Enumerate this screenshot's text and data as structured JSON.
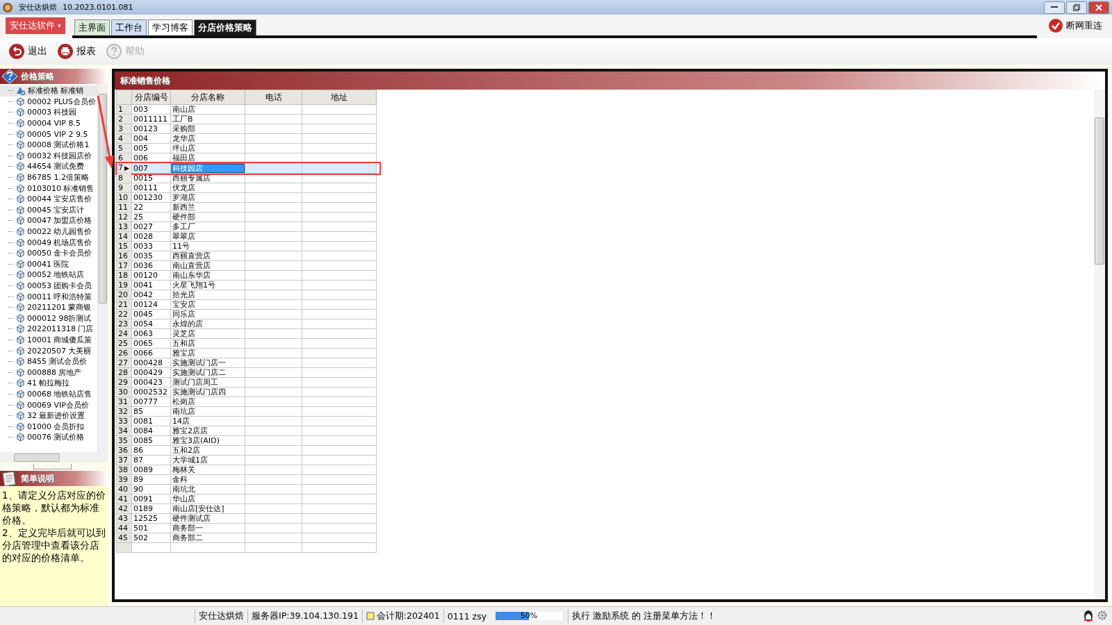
{
  "window": {
    "title": "安仕达烘焙",
    "version": "10.2023.0101.081"
  },
  "menu_button": {
    "label": "安仕达软件",
    "caret": "▾"
  },
  "tabs": [
    {
      "label": "主界面",
      "selected": false,
      "color": "#d8ecd8"
    },
    {
      "label": "工作台",
      "selected": false,
      "color": "#cfe0f5"
    },
    {
      "label": "学习博客",
      "selected": false,
      "color": "#ffffff"
    },
    {
      "label": "分店价格策略",
      "selected": true,
      "color": "#1a1a1a"
    }
  ],
  "reconnect_button": {
    "label": "断网重连"
  },
  "toolbar": [
    {
      "label": "退出",
      "kind": "exit",
      "disabled": false
    },
    {
      "label": "报表",
      "kind": "print",
      "disabled": false
    },
    {
      "label": "帮助",
      "kind": "help",
      "disabled": true
    }
  ],
  "price_tree": {
    "title": "价格策略",
    "items": [
      {
        "label": "标准价格 标准销",
        "kind": "root",
        "selected": true
      },
      {
        "label": "00002 PLUS会员价",
        "kind": "leaf",
        "selected": false
      },
      {
        "label": "00003 科技园",
        "kind": "leaf",
        "selected": false
      },
      {
        "label": "00004 VIP 8.5",
        "kind": "leaf",
        "selected": false
      },
      {
        "label": "00005 VIP 2 9.5",
        "kind": "leaf",
        "selected": false
      },
      {
        "label": "00008 测试价格1",
        "kind": "leaf",
        "selected": false
      },
      {
        "label": "00032 科技园店价",
        "kind": "leaf",
        "selected": false
      },
      {
        "label": "44654 测试免费",
        "kind": "leaf",
        "selected": false
      },
      {
        "label": "86785 1.2倍策略",
        "kind": "leaf",
        "selected": false
      },
      {
        "label": "0103010 标准销售",
        "kind": "leaf",
        "selected": false
      },
      {
        "label": "00044 宝安店售价",
        "kind": "leaf",
        "selected": false
      },
      {
        "label": "00045 宝安店计",
        "kind": "leaf",
        "selected": false
      },
      {
        "label": "00047 加盟店价格",
        "kind": "leaf",
        "selected": false
      },
      {
        "label": "00022 幼儿园售价",
        "kind": "leaf",
        "selected": false
      },
      {
        "label": "00049 机场店售价",
        "kind": "leaf",
        "selected": false
      },
      {
        "label": "00050 金卡会员价",
        "kind": "leaf",
        "selected": false
      },
      {
        "label": "00041 医院",
        "kind": "leaf",
        "selected": false
      },
      {
        "label": "00052 地铁站店",
        "kind": "leaf",
        "selected": false
      },
      {
        "label": "00053 团购卡会员",
        "kind": "leaf",
        "selected": false
      },
      {
        "label": "00011 呼和浩特策",
        "kind": "leaf",
        "selected": false
      },
      {
        "label": "20211201 蒙商银",
        "kind": "leaf",
        "selected": false
      },
      {
        "label": "000012 98折测试",
        "kind": "leaf",
        "selected": false
      },
      {
        "label": "2022011318 门店",
        "kind": "leaf",
        "selected": false
      },
      {
        "label": "10001 商城傻瓜策",
        "kind": "leaf",
        "selected": false
      },
      {
        "label": "20220507 大美丽",
        "kind": "leaf",
        "selected": false
      },
      {
        "label": "8455 测试会员价",
        "kind": "leaf",
        "selected": false
      },
      {
        "label": "000888 房地产",
        "kind": "leaf",
        "selected": false
      },
      {
        "label": "41 帕拉梅拉",
        "kind": "leaf",
        "selected": false
      },
      {
        "label": "00068 地铁站店售",
        "kind": "leaf",
        "selected": false
      },
      {
        "label": "00069 VIP会员价",
        "kind": "leaf",
        "selected": false
      },
      {
        "label": "32 最新进价设置",
        "kind": "leaf",
        "selected": false
      },
      {
        "label": "01000 会员折扣",
        "kind": "leaf",
        "selected": false
      },
      {
        "label": "00076 测试价格",
        "kind": "leaf",
        "selected": false
      }
    ]
  },
  "description": {
    "title": "简单说明",
    "paragraphs": [
      "1、请定义分店对应的价格策略，默认都为标准价格。",
      "2、定义完毕后就可以到分店管理中查看该分店的对应的价格清单。"
    ]
  },
  "table": {
    "title": "标准销售价格",
    "row_pointer": "▶",
    "columns": [
      "分店编号",
      "分店名称",
      "电话",
      "地址"
    ],
    "rows": [
      {
        "n": "1",
        "code": "003",
        "name": "南山店",
        "selected": false
      },
      {
        "n": "2",
        "code": "0011111",
        "name": "工厂B",
        "selected": false
      },
      {
        "n": "3",
        "code": "00123",
        "name": "采购部",
        "selected": false
      },
      {
        "n": "4",
        "code": "004",
        "name": "龙华店",
        "selected": false
      },
      {
        "n": "5",
        "code": "005",
        "name": "坪山店",
        "selected": false
      },
      {
        "n": "6",
        "code": "006",
        "name": "福田店",
        "selected": false
      },
      {
        "n": "7",
        "code": "007",
        "name": "科技园店",
        "selected": true
      },
      {
        "n": "8",
        "code": "0015",
        "name": "西丽专属店",
        "selected": false
      },
      {
        "n": "9",
        "code": "00111",
        "name": "伏龙店",
        "selected": false
      },
      {
        "n": "10",
        "code": "001230",
        "name": "罗湖店",
        "selected": false
      },
      {
        "n": "11",
        "code": "22",
        "name": "新西兰",
        "selected": false
      },
      {
        "n": "12",
        "code": "25",
        "name": "硬件部",
        "selected": false
      },
      {
        "n": "13",
        "code": "0027",
        "name": "多工厂",
        "selected": false
      },
      {
        "n": "14",
        "code": "0028",
        "name": "翠翠店",
        "selected": false
      },
      {
        "n": "15",
        "code": "0033",
        "name": "11号",
        "selected": false
      },
      {
        "n": "16",
        "code": "0035",
        "name": "西丽直营店",
        "selected": false
      },
      {
        "n": "17",
        "code": "0036",
        "name": "南山直营店",
        "selected": false
      },
      {
        "n": "18",
        "code": "00120",
        "name": "南山东华店",
        "selected": false
      },
      {
        "n": "19",
        "code": "0041",
        "name": "火星飞翔1号",
        "selected": false
      },
      {
        "n": "20",
        "code": "0042",
        "name": "拾光店",
        "selected": false
      },
      {
        "n": "21",
        "code": "00124",
        "name": "宝安店",
        "selected": false
      },
      {
        "n": "22",
        "code": "0045",
        "name": "同乐店",
        "selected": false
      },
      {
        "n": "23",
        "code": "0054",
        "name": "永煌的店",
        "selected": false
      },
      {
        "n": "24",
        "code": "0063",
        "name": "灵芝店",
        "selected": false
      },
      {
        "n": "25",
        "code": "0065",
        "name": "五和店",
        "selected": false
      },
      {
        "n": "26",
        "code": "0066",
        "name": "雅宝店",
        "selected": false
      },
      {
        "n": "27",
        "code": "000428",
        "name": "实施测试门店一",
        "selected": false
      },
      {
        "n": "28",
        "code": "000429",
        "name": "实施测试门店二",
        "selected": false
      },
      {
        "n": "29",
        "code": "000423",
        "name": "测试门店周工",
        "selected": false
      },
      {
        "n": "30",
        "code": "0002532",
        "name": "实施测试门店四",
        "selected": false
      },
      {
        "n": "31",
        "code": "00777",
        "name": "松岗店",
        "selected": false
      },
      {
        "n": "32",
        "code": "85",
        "name": "南坑店",
        "selected": false
      },
      {
        "n": "33",
        "code": "0081",
        "name": "14店",
        "selected": false
      },
      {
        "n": "34",
        "code": "0084",
        "name": "雅宝2店店",
        "selected": false
      },
      {
        "n": "35",
        "code": "0085",
        "name": "雅宝3店(AIO)",
        "selected": false
      },
      {
        "n": "36",
        "code": "86",
        "name": "五和2店",
        "selected": false
      },
      {
        "n": "37",
        "code": "87",
        "name": "大学城1店",
        "selected": false
      },
      {
        "n": "38",
        "code": "0089",
        "name": "梅林关",
        "selected": false
      },
      {
        "n": "39",
        "code": "89",
        "name": "金科",
        "selected": false
      },
      {
        "n": "40",
        "code": "90",
        "name": "南坑北",
        "selected": false
      },
      {
        "n": "41",
        "code": "0091",
        "name": "华山店",
        "selected": false
      },
      {
        "n": "42",
        "code": "0189",
        "name": "南山店[安仕达]",
        "selected": false
      },
      {
        "n": "43",
        "code": "12525",
        "name": "硬件测试店",
        "selected": false
      },
      {
        "n": "44",
        "code": "501",
        "name": "商务部一",
        "selected": false
      },
      {
        "n": "45",
        "code": "502",
        "name": "商务部二",
        "selected": false
      }
    ]
  },
  "status_bar": {
    "app": "安仕达烘焙",
    "server": "服务器IP:39.104.130.191",
    "period": "会计期:202401",
    "user": "0111 zsy",
    "progress": {
      "level": 0.5,
      "reading": "50%"
    },
    "message": "执行 激励系统 的 注册菜单方法！！"
  }
}
